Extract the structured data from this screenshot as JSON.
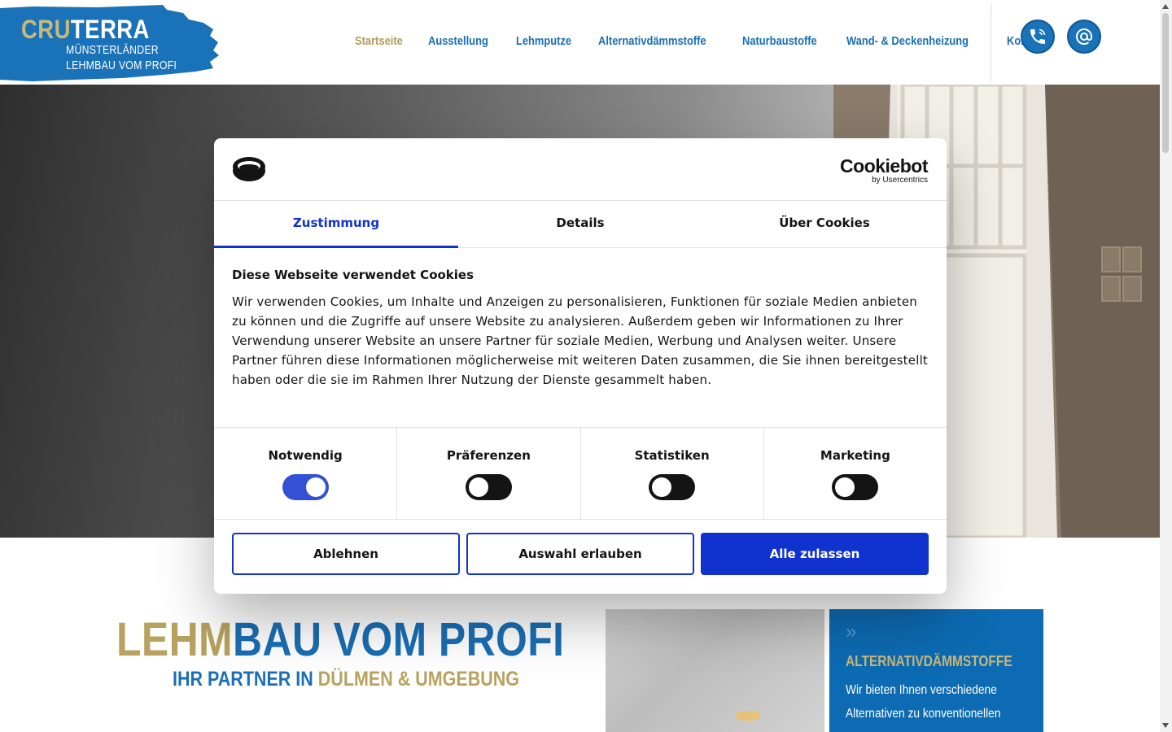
{
  "header": {
    "logo": {
      "brand_part1": "CRU",
      "brand_part2": "TERRA",
      "line1": "MÜNSTERLÄNDER",
      "line2": "LEHMBAU VOM PROFI"
    },
    "nav": [
      {
        "label": "Startseite",
        "active": true
      },
      {
        "label": "Ausstellung",
        "active": false
      },
      {
        "label": "Lehmputze",
        "active": false
      },
      {
        "label": "Alternativdämmstoffe",
        "active": false
      },
      {
        "label": "Naturbaustoffe",
        "active": false
      },
      {
        "label": "Wand- & Deckenheizung",
        "active": false
      },
      {
        "label": "Kontakt",
        "active": false
      }
    ],
    "icons": [
      "phone-icon",
      "at-sign-icon"
    ]
  },
  "cookie_dialog": {
    "brand": "Cookiebot",
    "brand_sub": "by Usercentrics",
    "tabs": [
      {
        "label": "Zustimmung",
        "active": true
      },
      {
        "label": "Details",
        "active": false
      },
      {
        "label": "Über Cookies",
        "active": false
      }
    ],
    "title": "Diese Webseite verwendet Cookies",
    "text": "Wir verwenden Cookies, um Inhalte und Anzeigen zu personalisieren, Funktionen für soziale Medien anbieten zu können und die Zugriffe auf unsere Website zu analysieren. Außerdem geben wir Informationen zu Ihrer Verwendung unserer Website an unsere Partner für soziale Medien, Werbung und Analysen weiter. Unsere Partner führen diese Informationen möglicherweise mit weiteren Daten zusammen, die Sie ihnen bereitgestellt haben oder die sie im Rahmen Ihrer Nutzung der Dienste gesammelt haben.",
    "toggles": [
      {
        "label": "Notwendig",
        "on": true
      },
      {
        "label": "Präferenzen",
        "on": false
      },
      {
        "label": "Statistiken",
        "on": false
      },
      {
        "label": "Marketing",
        "on": false
      }
    ],
    "buttons": {
      "deny": "Ablehnen",
      "allow_selection": "Auswahl erlauben",
      "allow_all": "Alle zulassen"
    },
    "colors": {
      "accent": "#1032cf"
    }
  },
  "content": {
    "headline_gold": "LEHM",
    "headline_blue": "BAU VOM PROFI",
    "sub_blue": "IHR PARTNER IN ",
    "sub_gold": "DÜLMEN & UMGEBUNG",
    "card": {
      "title": "ALTERNATIVDÄMMSTOFFE",
      "line1": "Wir bieten Ihnen verschiedene",
      "line2": "Alternativen zu konventionellen"
    }
  },
  "colors": {
    "brand_blue": "#1a6fb4",
    "brand_gold": "#b7a35f"
  }
}
